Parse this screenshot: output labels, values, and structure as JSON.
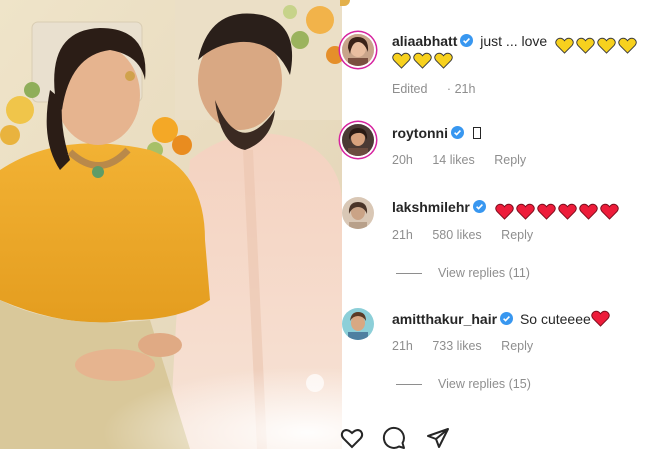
{
  "post": {
    "photo_alt": "couple-photo"
  },
  "comments": [
    {
      "username": "aliaabhatt",
      "verified": true,
      "text": "just ... love",
      "hearts": {
        "count": 7,
        "color": "#f7d11e"
      },
      "edited_label": "Edited",
      "time": "21h"
    },
    {
      "username": "roytonni",
      "verified": true,
      "text": "",
      "time": "20h",
      "likes": "14 likes",
      "reply_label": "Reply"
    },
    {
      "username": "lakshmilehr",
      "verified": true,
      "hearts": {
        "count": 6,
        "color": "#ed1c3a"
      },
      "time": "21h",
      "likes": "580 likes",
      "reply_label": "Reply",
      "view_replies": "View replies (11)"
    },
    {
      "username": "amitthakur_hair",
      "verified": true,
      "text": "So cuteeee",
      "hearts": {
        "count": 1,
        "color": "#ed1c3a"
      },
      "time": "21h",
      "likes": "733 likes",
      "reply_label": "Reply",
      "view_replies": "View replies (15)"
    }
  ],
  "actions": {
    "like_icon": "heart-outline-icon",
    "comment_icon": "comment-bubble-icon",
    "share_icon": "paper-plane-icon"
  },
  "colors": {
    "verified_blue": "#3897f0",
    "meta_gray": "#8e8e8e",
    "text_dark": "#262626",
    "story_ring": "#d6249f"
  }
}
